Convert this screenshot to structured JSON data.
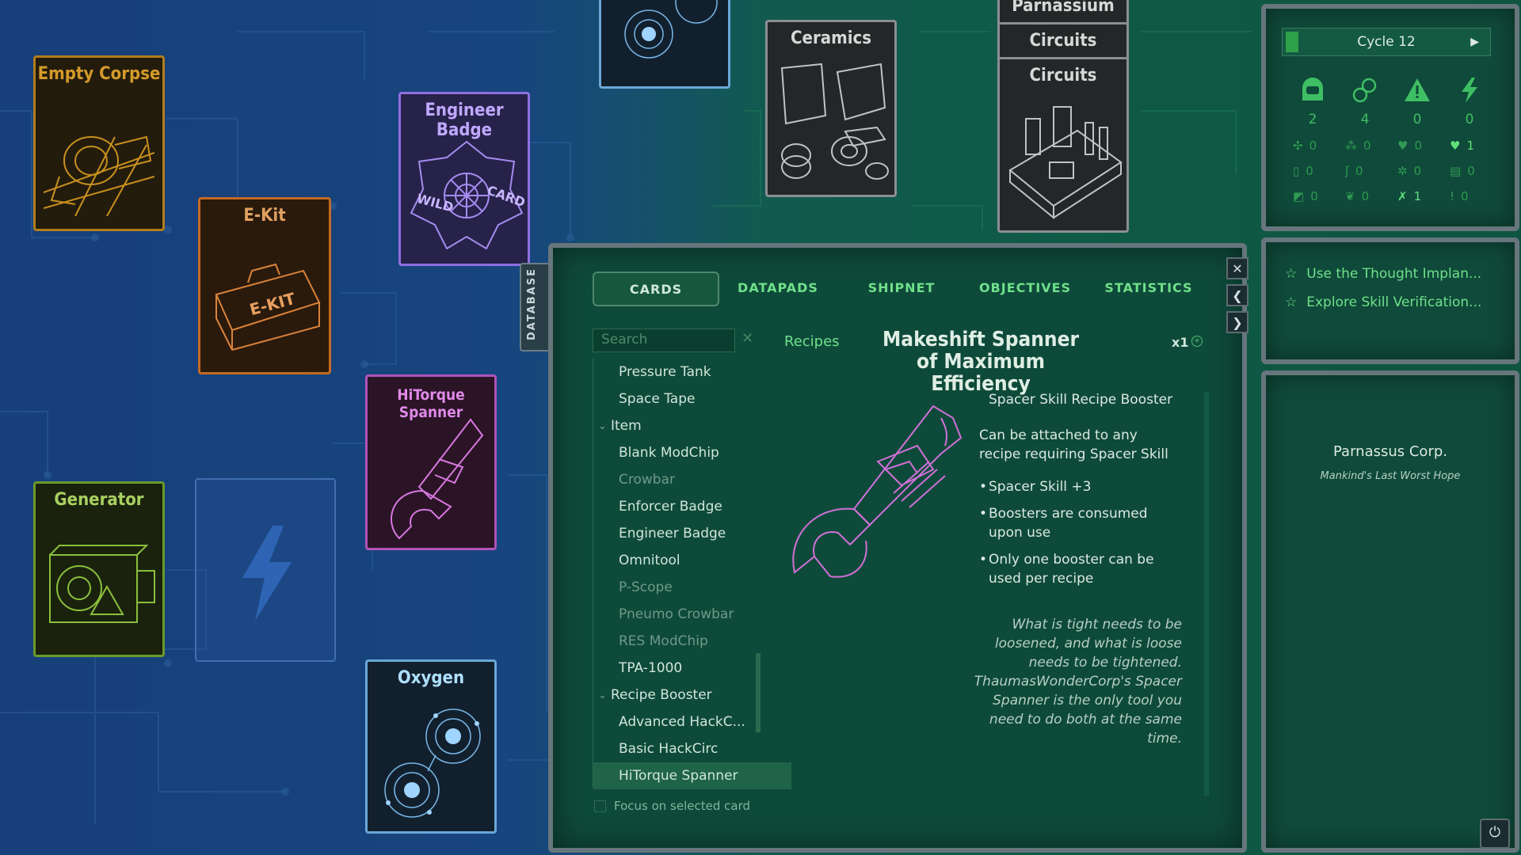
{
  "board": {
    "cards": {
      "empty_corpse": "Empty Corpse",
      "e_kit": "E-Kit",
      "engineer_badge": "Engineer Badge",
      "hitorque_spanner": "HiTorque Spanner",
      "generator": "Generator",
      "oxygen": "Oxygen",
      "ceramics": "Ceramics",
      "parnassium": "Parnassium",
      "circuits_1": "Circuits",
      "circuits_2": "Circuits"
    },
    "card_art_text": {
      "e_kit_label": "E-KIT",
      "badge_left": "WILD",
      "badge_right": "CARD"
    }
  },
  "database_tab": "DATABASE",
  "panel": {
    "tabs": [
      "CARDS",
      "DATAPADS",
      "SHIPNET",
      "OBJECTIVES",
      "STATISTICS"
    ],
    "active_tab": "CARDS",
    "search_placeholder": "Search",
    "tree": [
      {
        "type": "leaf",
        "label": "Pressure Tank",
        "dim": false
      },
      {
        "type": "leaf",
        "label": "Space Tape",
        "dim": false
      },
      {
        "type": "group",
        "label": "Item"
      },
      {
        "type": "leaf",
        "label": "Blank ModChip",
        "dim": false
      },
      {
        "type": "leaf",
        "label": "Crowbar",
        "dim": true
      },
      {
        "type": "leaf",
        "label": "Enforcer Badge",
        "dim": false
      },
      {
        "type": "leaf",
        "label": "Engineer Badge",
        "dim": false
      },
      {
        "type": "leaf",
        "label": "Omnitool",
        "dim": false
      },
      {
        "type": "leaf",
        "label": "P-Scope",
        "dim": true
      },
      {
        "type": "leaf",
        "label": "Pneumo Crowbar",
        "dim": true
      },
      {
        "type": "leaf",
        "label": "RES ModChip",
        "dim": true
      },
      {
        "type": "leaf",
        "label": "TPA-1000",
        "dim": false
      },
      {
        "type": "group",
        "label": "Recipe Booster"
      },
      {
        "type": "leaf",
        "label": "Advanced HackC...",
        "dim": false
      },
      {
        "type": "leaf",
        "label": "Basic HackCirc",
        "dim": false
      },
      {
        "type": "leaf",
        "label": "HiTorque Spanner",
        "dim": false,
        "selected": true
      }
    ],
    "focus_label": "Focus on selected card",
    "detail": {
      "recipes_link": "Recipes",
      "title": "Makeshift Spanner of Maximum Efficiency",
      "quantity": "x1",
      "subtype": "Spacer Skill Recipe Booster",
      "description": "Can be attached to any recipe requiring Spacer Skill",
      "bullets": [
        "Spacer Skill +3",
        "Boosters are consumed upon use",
        "Only one booster can be used per recipe"
      ],
      "flavor": "What is tight needs to be loosened, and what is loose needs to be tightened. ThaumasWonderCorp's Spacer Spanner is the only tool you need to do both at the same time."
    },
    "side_buttons": [
      "close-icon",
      "chevron-left-icon",
      "chevron-right-icon"
    ]
  },
  "status": {
    "cycle_label": "Cycle 12",
    "main_stats": [
      {
        "icon": "helmet-icon",
        "value": "2"
      },
      {
        "icon": "molecule-icon",
        "value": "4"
      },
      {
        "icon": "warning-icon",
        "value": "0"
      },
      {
        "icon": "lightning-icon",
        "value": "0"
      }
    ],
    "mini_stats": [
      [
        "0",
        "0",
        "0",
        "1"
      ],
      [
        "0",
        "0",
        "0",
        "0"
      ],
      [
        "0",
        "0",
        "1",
        "0"
      ]
    ]
  },
  "objectives": [
    "Use the Thought Implan...",
    "Explore Skill Verification..."
  ],
  "company": {
    "name": "Parnassus Corp.",
    "motto": "Mankind's Last Worst Hope"
  },
  "colors": {
    "accent_green": "#3fbf63",
    "panel_bg": "#0e4a3a",
    "frame": "#66767c"
  }
}
